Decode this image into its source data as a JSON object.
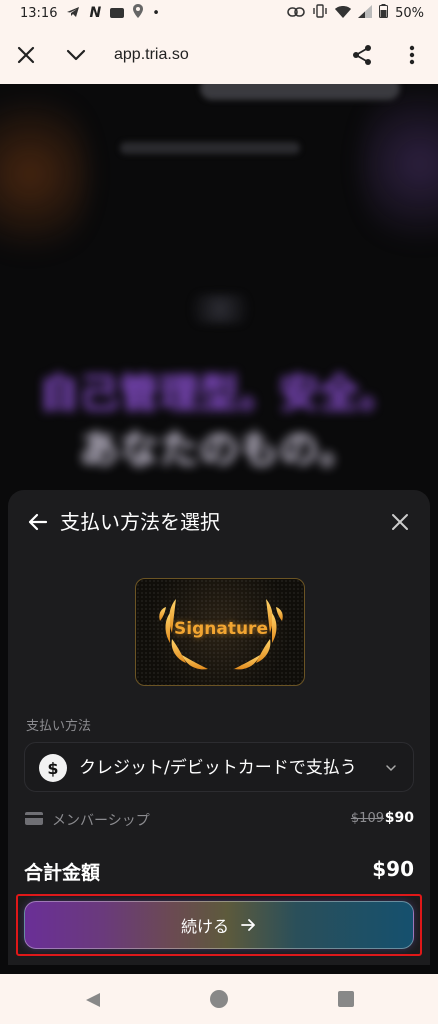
{
  "status_bar": {
    "time": "13:16",
    "left_glyphs": [
      "telegram-icon",
      "n-icon",
      "notification-icon",
      "location-icon",
      "dot-icon"
    ],
    "battery": "50%"
  },
  "browser": {
    "url": "app.tria.so"
  },
  "background": {
    "headline_line1": "自己管理型。安全。",
    "headline_line2": "あなたのもの。"
  },
  "sheet": {
    "title": "支払い方法を選択",
    "card_label": "Signature",
    "payment_method_label": "支払い方法",
    "payment_method_value": "クレジット/デビットカードで支払う",
    "payment_method_icon": "$",
    "membership_label": "メンバーシップ",
    "price_original": "$109",
    "price_current": "$90",
    "total_label": "合計金額",
    "total_value": "$90",
    "cta_label": "続ける"
  },
  "colors": {
    "sheet_bg": "#1c1c1e",
    "card_gold": "#f2a531",
    "highlight": "#e01818"
  }
}
